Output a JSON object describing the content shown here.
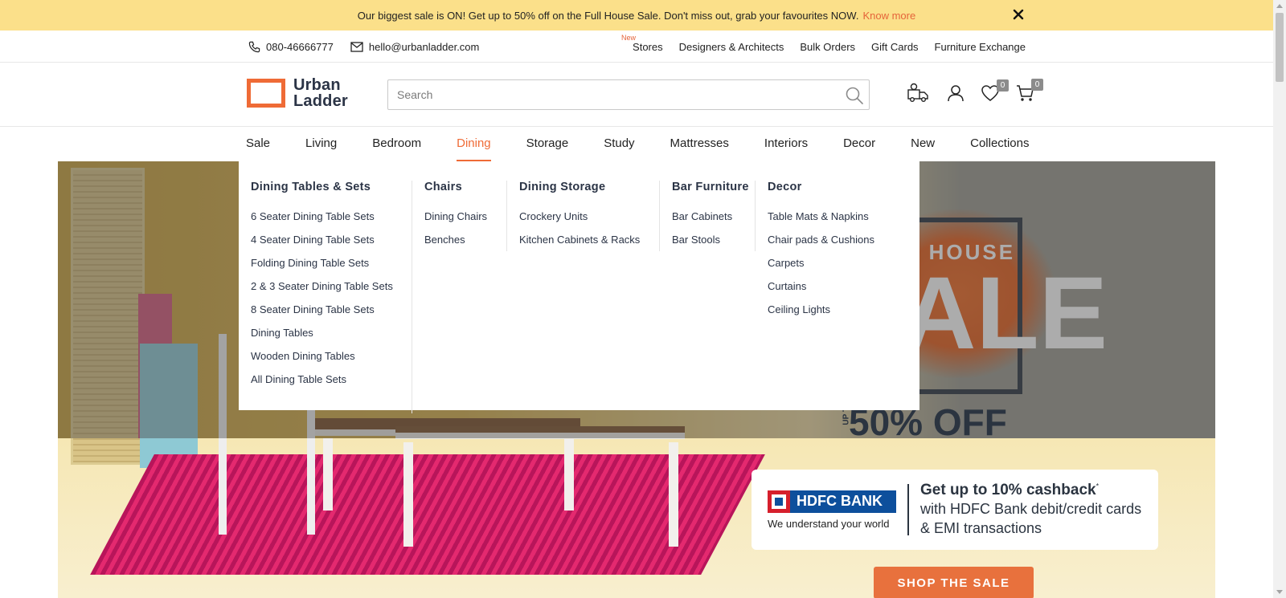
{
  "promo": {
    "text": "Our biggest sale is ON! Get up to 50% off on the Full House Sale. Don't miss out, grab your favourites NOW.",
    "link": "Know more",
    "close_icon": "close-icon"
  },
  "util": {
    "phone": "080-46666777",
    "email": "hello@urbanladder.com",
    "new_badge": "New",
    "links": [
      "Stores",
      "Designers & Architects",
      "Bulk Orders",
      "Gift Cards",
      "Furniture Exchange"
    ]
  },
  "header": {
    "logo_line1": "Urban",
    "logo_line2": "Ladder",
    "search_placeholder": "Search",
    "wishlist_count": "0",
    "cart_count": "0",
    "icons": [
      "track-order-icon",
      "account-icon",
      "wishlist-icon",
      "cart-icon"
    ]
  },
  "nav": {
    "items": [
      "Sale",
      "Living",
      "Bedroom",
      "Dining",
      "Storage",
      "Study",
      "Mattresses",
      "Interiors",
      "Decor",
      "New",
      "Collections"
    ],
    "active": "Dining"
  },
  "mega": {
    "columns": [
      {
        "title": "Dining Tables & Sets",
        "items": [
          "6 Seater Dining Table Sets",
          "4 Seater Dining Table Sets",
          "Folding Dining Table Sets",
          "2 & 3 Seater Dining Table Sets",
          "8 Seater Dining Table Sets",
          "Dining Tables",
          "Wooden Dining Tables",
          "All Dining Table Sets"
        ]
      },
      {
        "title": "Chairs",
        "items": [
          "Dining Chairs",
          "Benches"
        ]
      },
      {
        "title": "Dining Storage",
        "items": [
          "Crockery Units",
          "Kitchen Cabinets & Racks"
        ]
      },
      {
        "title": "Bar Furniture",
        "items": [
          "Bar Cabinets",
          "Bar Stools"
        ]
      },
      {
        "title": "Decor",
        "items": [
          "Table Mats & Napkins",
          "Chair pads & Cushions",
          "Carpets",
          "Curtains",
          "Ceiling Lights"
        ]
      }
    ]
  },
  "hero": {
    "sale_line": "L HOUSE",
    "sale_big": "ALE",
    "upto": "UP TO",
    "off": "50% OFF",
    "bank_name": "HDFC BANK",
    "bank_tagline": "We understand your world",
    "offer_title": "Get up to 10% cashback",
    "offer_star": "*",
    "offer_line1": "with HDFC Bank debit/credit cards",
    "offer_line2": "& EMI transactions",
    "cta": "SHOP THE SALE"
  },
  "colors": {
    "accent": "#ef6b36",
    "promo_bg": "#fbe08a",
    "text_dark": "#2b3446"
  }
}
